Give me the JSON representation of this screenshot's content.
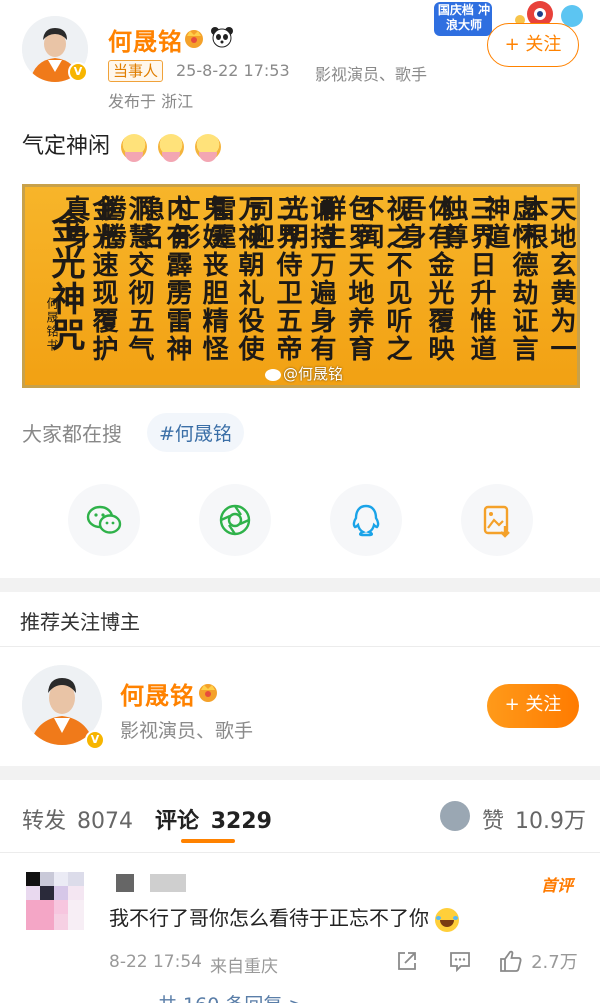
{
  "post": {
    "author": "何晟铭",
    "badge_label": "当事人",
    "datetime": "25-8-22 17:53",
    "role": "影视演员、歌手",
    "location": "发布于 浙江",
    "follow_label": "+ 关注",
    "corner_badge_text": "国庆档 冲浪大师",
    "text": "气定神闲",
    "watermark": "@何晟铭"
  },
  "search": {
    "label": "大家都在搜",
    "chip": "#何晟铭"
  },
  "share": {
    "icons": [
      "wechat-icon",
      "moments-icon",
      "qq-icon",
      "save-image-icon"
    ]
  },
  "recommend": {
    "title": "推荐关注博主",
    "name": "何晟铭",
    "desc": "影视演员、歌手",
    "follow_label": "+ 关注"
  },
  "stats": {
    "repost_label": "转发",
    "repost_count": "8074",
    "comment_label": "评论",
    "comment_count": "3229",
    "like_label": "赞",
    "like_count": "10.9万"
  },
  "comment": {
    "text": "我不行了哥你怎么看待于正忘不了你",
    "hot_label": "首评",
    "datetime": "8-22 17:54",
    "location": "来自重庆",
    "like_count": "2.7万",
    "reply_link": "共 160 条回复 >"
  },
  "calligraphy_text": {
    "col1": "天地玄黄为一本根",
    "col2": "虚怀德劫证言神道",
    "col3": "三界日升惟道独尊",
    "col4": "体有金光覆映吾身",
    "col5": "视之不见听之不闻",
    "col6": "包罗天地养育群生",
    "col7": "诵持万遍身有光明",
    "col8": "三界侍卫五帝司迎",
    "col9": "万神朝礼役使雷霆",
    "col10": "鬼妖丧胆精怪亡形",
    "col11": "内有霹雳雷神隐名",
    "col12": "洞慧交彻五气腾腾",
    "col13": "金光速现覆护真身",
    "col14": "金光神咒",
    "signature": "何晟铭书"
  },
  "colors": {
    "accent": "#ff8200",
    "link": "#3b6fa7",
    "calligraphy_bg": "#f2a113"
  }
}
